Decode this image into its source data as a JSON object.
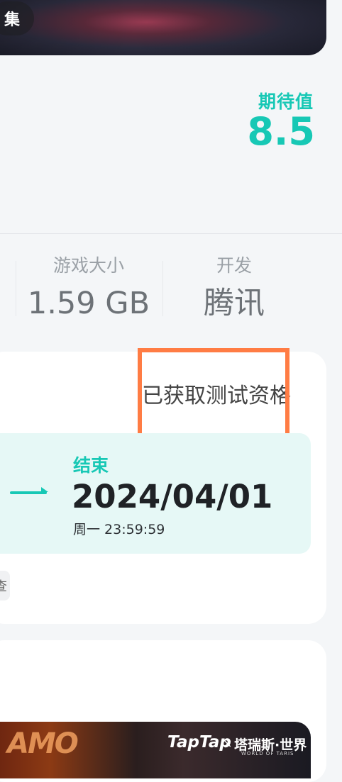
{
  "banner": {
    "chip_label": "集"
  },
  "rating": {
    "label": "期待值",
    "value": "8.5"
  },
  "stats": [
    {
      "label": "游戏大小",
      "value": "1.59 GB"
    },
    {
      "label": "开发",
      "value": "腾讯"
    }
  ],
  "test": {
    "status": "已获取测试资格",
    "end_label": "结束",
    "end_date": "2024/04/01",
    "end_time": "周一  23:59:59",
    "chip_text": "查"
  },
  "promo": {
    "brand": "TapTap",
    "separator": "×",
    "game_name": "塔瑞斯·世界",
    "game_sub": "WORLD OF TARIS",
    "art_text": "AMO"
  },
  "colors": {
    "accent": "#17c8b5",
    "highlight": "#ff7c44"
  }
}
